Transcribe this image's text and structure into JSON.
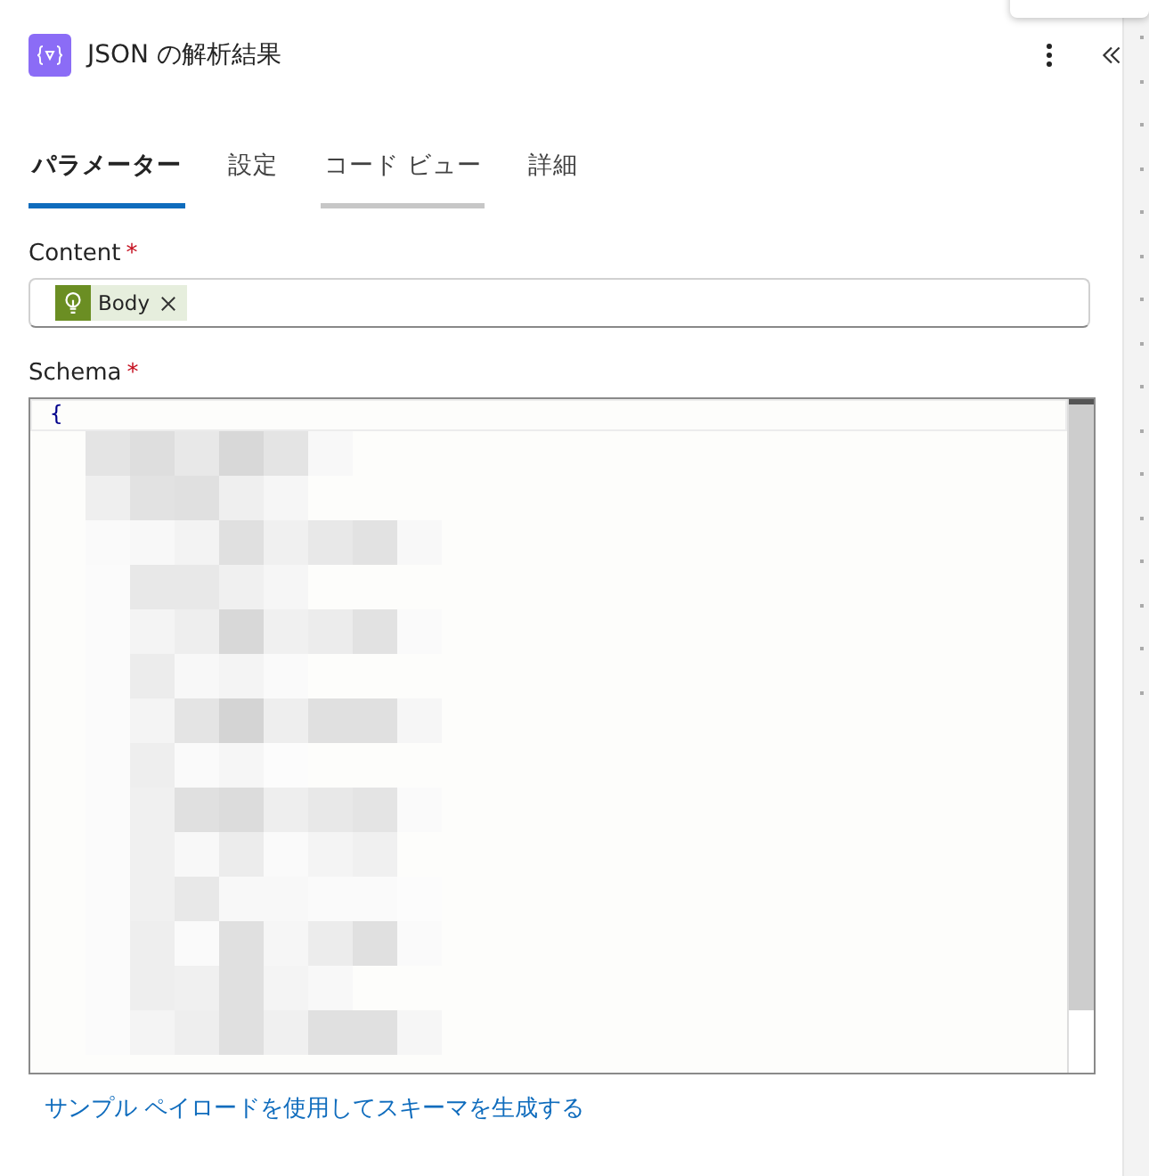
{
  "header": {
    "title": "JSON の解析結果"
  },
  "tabs": [
    {
      "label": "パラメーター",
      "selected": true,
      "hovered": false
    },
    {
      "label": "設定",
      "selected": false,
      "hovered": false
    },
    {
      "label": "コード ビュー",
      "selected": false,
      "hovered": true
    },
    {
      "label": "詳細",
      "selected": false,
      "hovered": false
    }
  ],
  "fields": [
    {
      "label": "Content",
      "required_mark": "*",
      "kind": "token",
      "token": "Body"
    },
    {
      "label": "Schema",
      "required_mark": "*",
      "kind": "code",
      "first_line": "{"
    }
  ],
  "link": "サンプル ペイロードを使用してスキーマを生成する"
}
